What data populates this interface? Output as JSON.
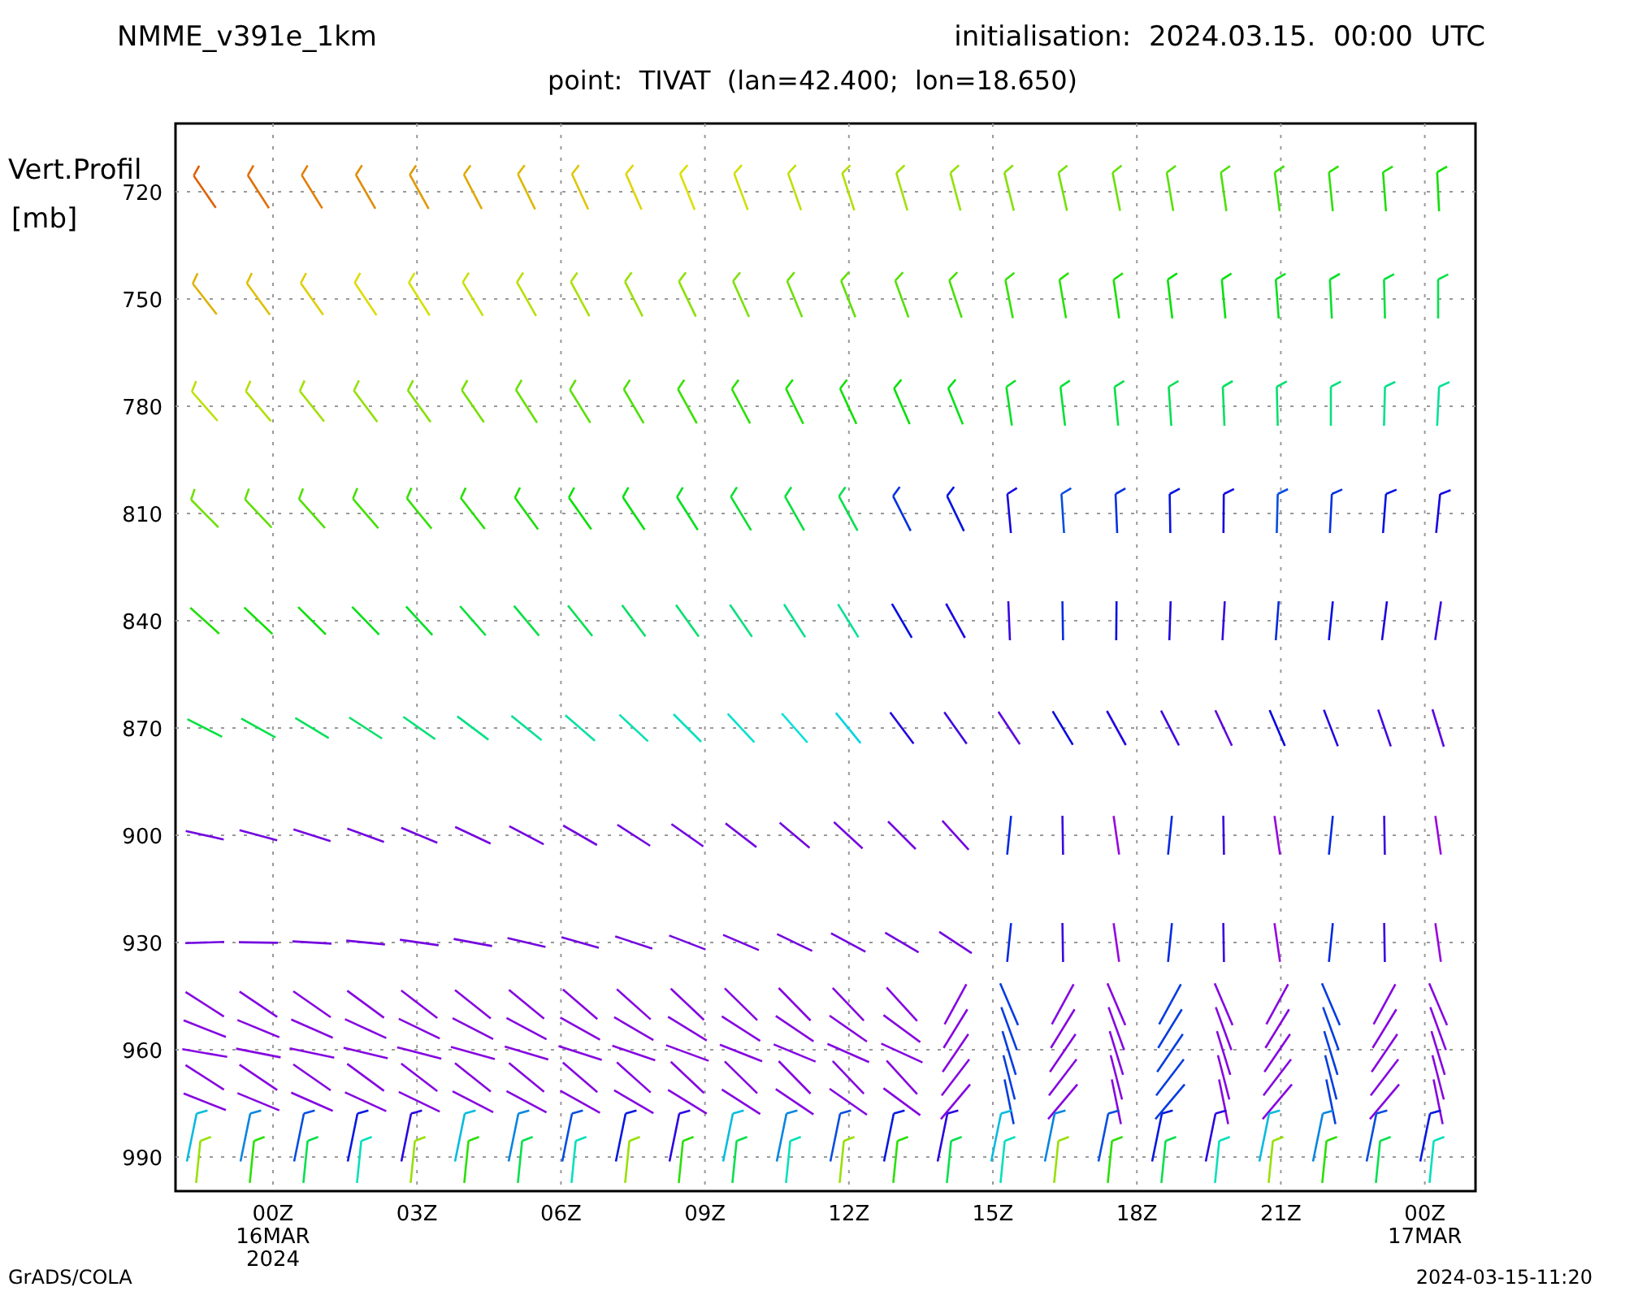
{
  "header": {
    "model": "NMME_v391e_1km",
    "initialisation": "initialisation:  2024.03.15.  00:00  UTC"
  },
  "subtitle": "point:  TIVAT  (lan=42.400;  lon=18.650)",
  "y_axis": {
    "title": "Vert.Profil",
    "unit": "[mb]",
    "ticks": [
      "720",
      "750",
      "780",
      "810",
      "840",
      "870",
      "900",
      "930",
      "960",
      "990"
    ]
  },
  "x_axis": {
    "ticks": [
      {
        "label": "00Z",
        "date": "16MAR",
        "year": "2024"
      },
      {
        "label": "03Z"
      },
      {
        "label": "06Z"
      },
      {
        "label": "09Z"
      },
      {
        "label": "12Z"
      },
      {
        "label": "15Z"
      },
      {
        "label": "18Z"
      },
      {
        "label": "21Z"
      },
      {
        "label": "00Z",
        "date": "17MAR"
      }
    ]
  },
  "footer": {
    "source": "GrADS/COLA",
    "timestamp": "2024-03-15-11:20"
  }
}
